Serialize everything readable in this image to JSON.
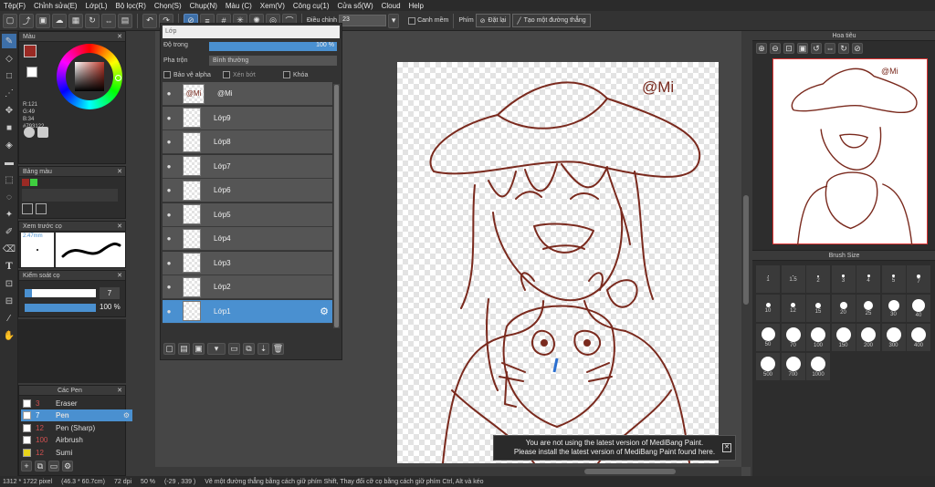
{
  "menu": [
    "Tệp(F)",
    "Chỉnh sửa(E)",
    "Lớp(L)",
    "Bộ lọc(R)",
    "Chọn(S)",
    "Chụp(N)",
    "Màu (C)",
    "Xem(V)",
    "Công cụ(1)",
    "Cửa sổ(W)",
    "Cloud",
    "Help"
  ],
  "toolbar": {
    "dieu_chinh_label": "Điều chỉnh",
    "dieu_chinh_value": "23",
    "canh_mem_label": "Canh mềm",
    "phim_label": "Phím",
    "dat_lai_label": "Đặt lại",
    "tao_duong_thang_label": "Tạo một đường thẳng"
  },
  "color_panel": {
    "title": "Màu",
    "r": "R:121",
    "g": "G:49",
    "b": "B:34",
    "hex": "#793122",
    "primary_color": "#9a2a24",
    "secondary_color": "#ffffff"
  },
  "palette_panel": {
    "title": "Bảng màu",
    "swatches": [
      "#9a2a24",
      "#3fcf3f"
    ]
  },
  "brush_preview": {
    "title": "Xem trước cọ",
    "size": "2.47mm"
  },
  "brush_control": {
    "title": "Kiểm soát cọ",
    "size_value": "7",
    "opacity_value": "100 %"
  },
  "pens_panel": {
    "title": "Các Pen",
    "items": [
      {
        "size": "3",
        "name": "Eraser",
        "color": "#ffffff"
      },
      {
        "size": "7",
        "name": "Pen",
        "color": "#ffffff"
      },
      {
        "size": "12",
        "name": "Pen (Sharp)",
        "color": "#ffffff"
      },
      {
        "size": "100",
        "name": "Airbrush",
        "color": "#ffffff"
      },
      {
        "size": "12",
        "name": "Sumi",
        "color": "#e8d41a"
      }
    ],
    "selected_index": 1
  },
  "layers_panel": {
    "title": "Lớp",
    "opacity_label": "Độ trong",
    "opacity_value": "100 %",
    "opacity_fraction": 1.0,
    "blend_label": "Pha trộn",
    "blend_value": "Bình thường",
    "protect_alpha": "Bảo vệ alpha",
    "clipping": "Xén bớt",
    "lock": "Khóa",
    "layers": [
      {
        "name": "@Mi",
        "thumb": "@Mi"
      },
      {
        "name": "Lớp9"
      },
      {
        "name": "Lớp8"
      },
      {
        "name": "Lớp7"
      },
      {
        "name": "Lớp6"
      },
      {
        "name": "Lớp5"
      },
      {
        "name": "Lớp4"
      },
      {
        "name": "Lớp3"
      },
      {
        "name": "Lớp2"
      },
      {
        "name": "Lớp1"
      }
    ],
    "selected_index": 9
  },
  "canvas": {
    "signature": "@Mi",
    "line_color": "#7a2a1e"
  },
  "navigator": {
    "title": "Hoa tiêu"
  },
  "brush_size_panel": {
    "title": "Brush Size",
    "sizes": [
      "1",
      "1.5",
      "2",
      "3",
      "4",
      "5",
      "7",
      "10",
      "12",
      "15",
      "20",
      "25",
      "30",
      "40",
      "50",
      "70",
      "100",
      "150",
      "200",
      "300",
      "400",
      "500",
      "700",
      "1000"
    ]
  },
  "notice": {
    "line1": "You are not using the latest version of MediBang Paint.",
    "line2": "Please install the latest version of MediBang Paint found here."
  },
  "status": {
    "size": "1312 * 1722 pixel",
    "physical": "(46.3 * 60.7cm)",
    "dpi": "72 dpi",
    "zoom": "50 %",
    "coords": "(-29 , 339 )",
    "hint": "Vẽ một đường thẳng bằng cách giữ phím Shift, Thay đổi cỡ cọ bằng cách giữ phím Ctrl, Alt và kéo"
  }
}
